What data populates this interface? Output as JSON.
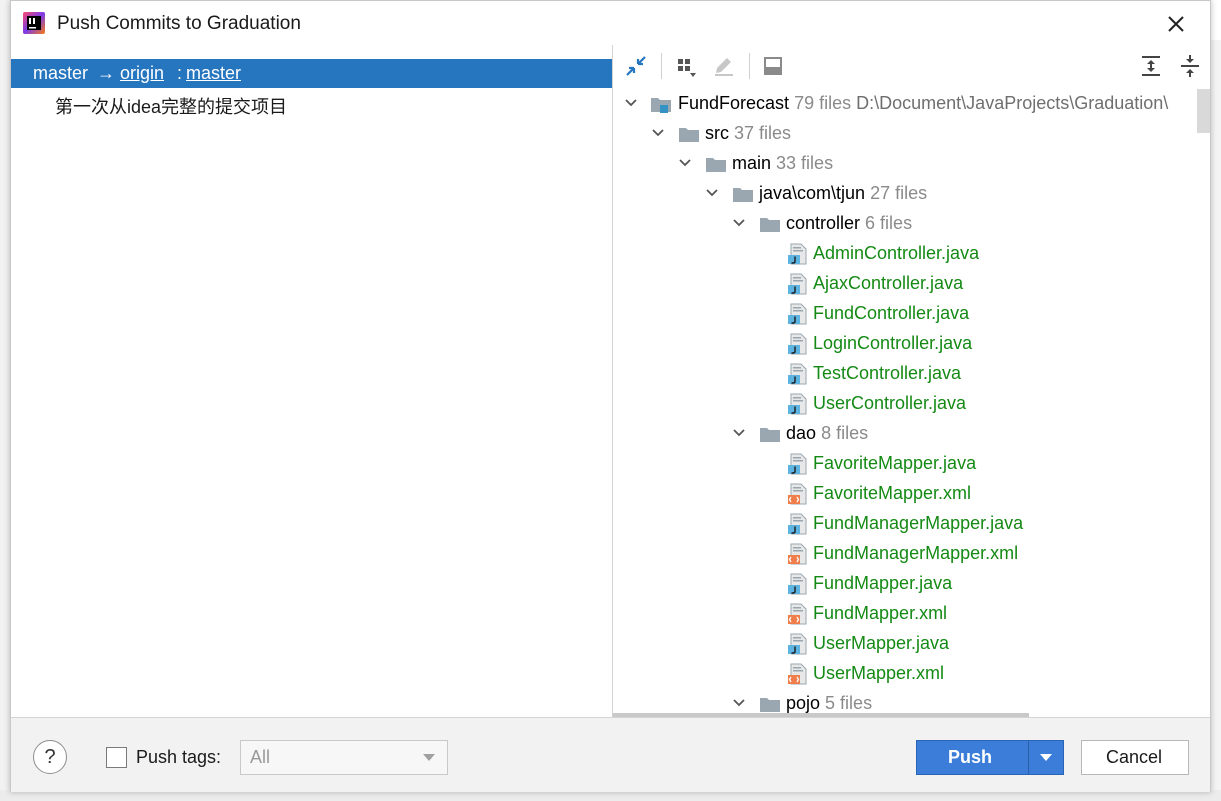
{
  "window": {
    "title": "Push Commits to Graduation"
  },
  "branch": {
    "local": "master",
    "arrow": "→",
    "remote": "origin",
    "separator": ":",
    "remote_branch": "master"
  },
  "commit": {
    "message": "第一次从idea完整的提交项目"
  },
  "tree": {
    "root": {
      "name": "FundForecast",
      "count": "79 files",
      "path": "D:\\Document\\JavaProjects\\Graduation\\"
    },
    "src": {
      "name": "src",
      "count": "37 files"
    },
    "main": {
      "name": "main",
      "count": "33 files"
    },
    "pkg": {
      "name": "java\\com\\tjun",
      "count": "27 files"
    },
    "controller": {
      "name": "controller",
      "count": "6 files",
      "files": [
        "AdminController.java",
        "AjaxController.java",
        "FundController.java",
        "LoginController.java",
        "TestController.java",
        "UserController.java"
      ]
    },
    "dao": {
      "name": "dao",
      "count": "8 files",
      "files": [
        "FavoriteMapper.java",
        "FavoriteMapper.xml",
        "FundManagerMapper.java",
        "FundManagerMapper.xml",
        "FundMapper.java",
        "FundMapper.xml",
        "UserMapper.java",
        "UserMapper.xml"
      ]
    },
    "pojo": {
      "name": "pojo",
      "count": "5 files"
    }
  },
  "footer": {
    "help": "?",
    "push_tags_label": "Push tags:",
    "tags_select_value": "All",
    "push_label": "Push",
    "cancel_label": "Cancel"
  },
  "colors": {
    "selection": "#2675bf",
    "added_file": "#148a14",
    "primary_button": "#3b7dd8"
  }
}
